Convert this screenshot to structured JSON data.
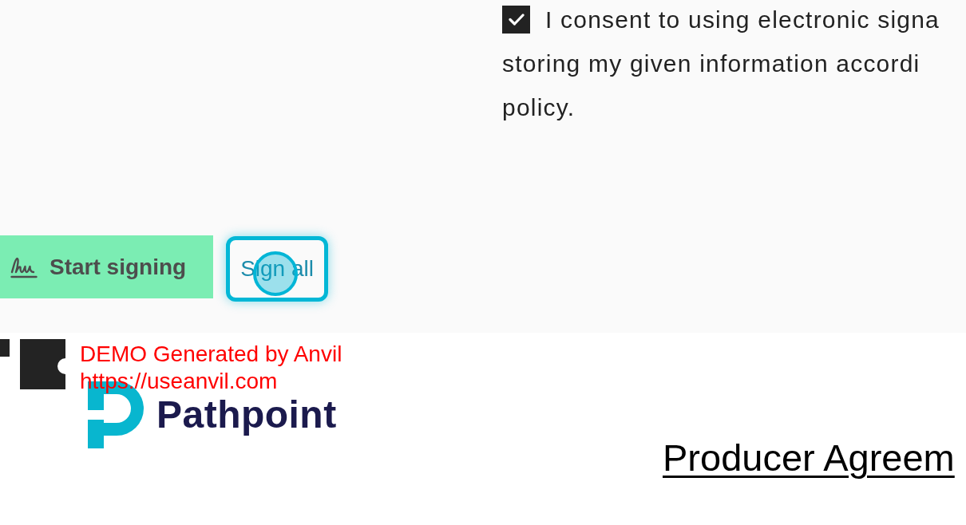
{
  "consent": {
    "checked": true,
    "lines": [
      "I consent to using electronic signa",
      "storing my given information accordi",
      "policy."
    ]
  },
  "actions": [
    {
      "kind": "primary",
      "label": "Start signing"
    },
    {
      "kind": "outline",
      "label": "Sign all",
      "focused": true
    }
  ],
  "demo_notice": {
    "lines": [
      "DEMO Generated by Anvil",
      "https://useanvil.com"
    ]
  },
  "document": {
    "company": "Pathpoint",
    "title": "Producer Agreem"
  }
}
